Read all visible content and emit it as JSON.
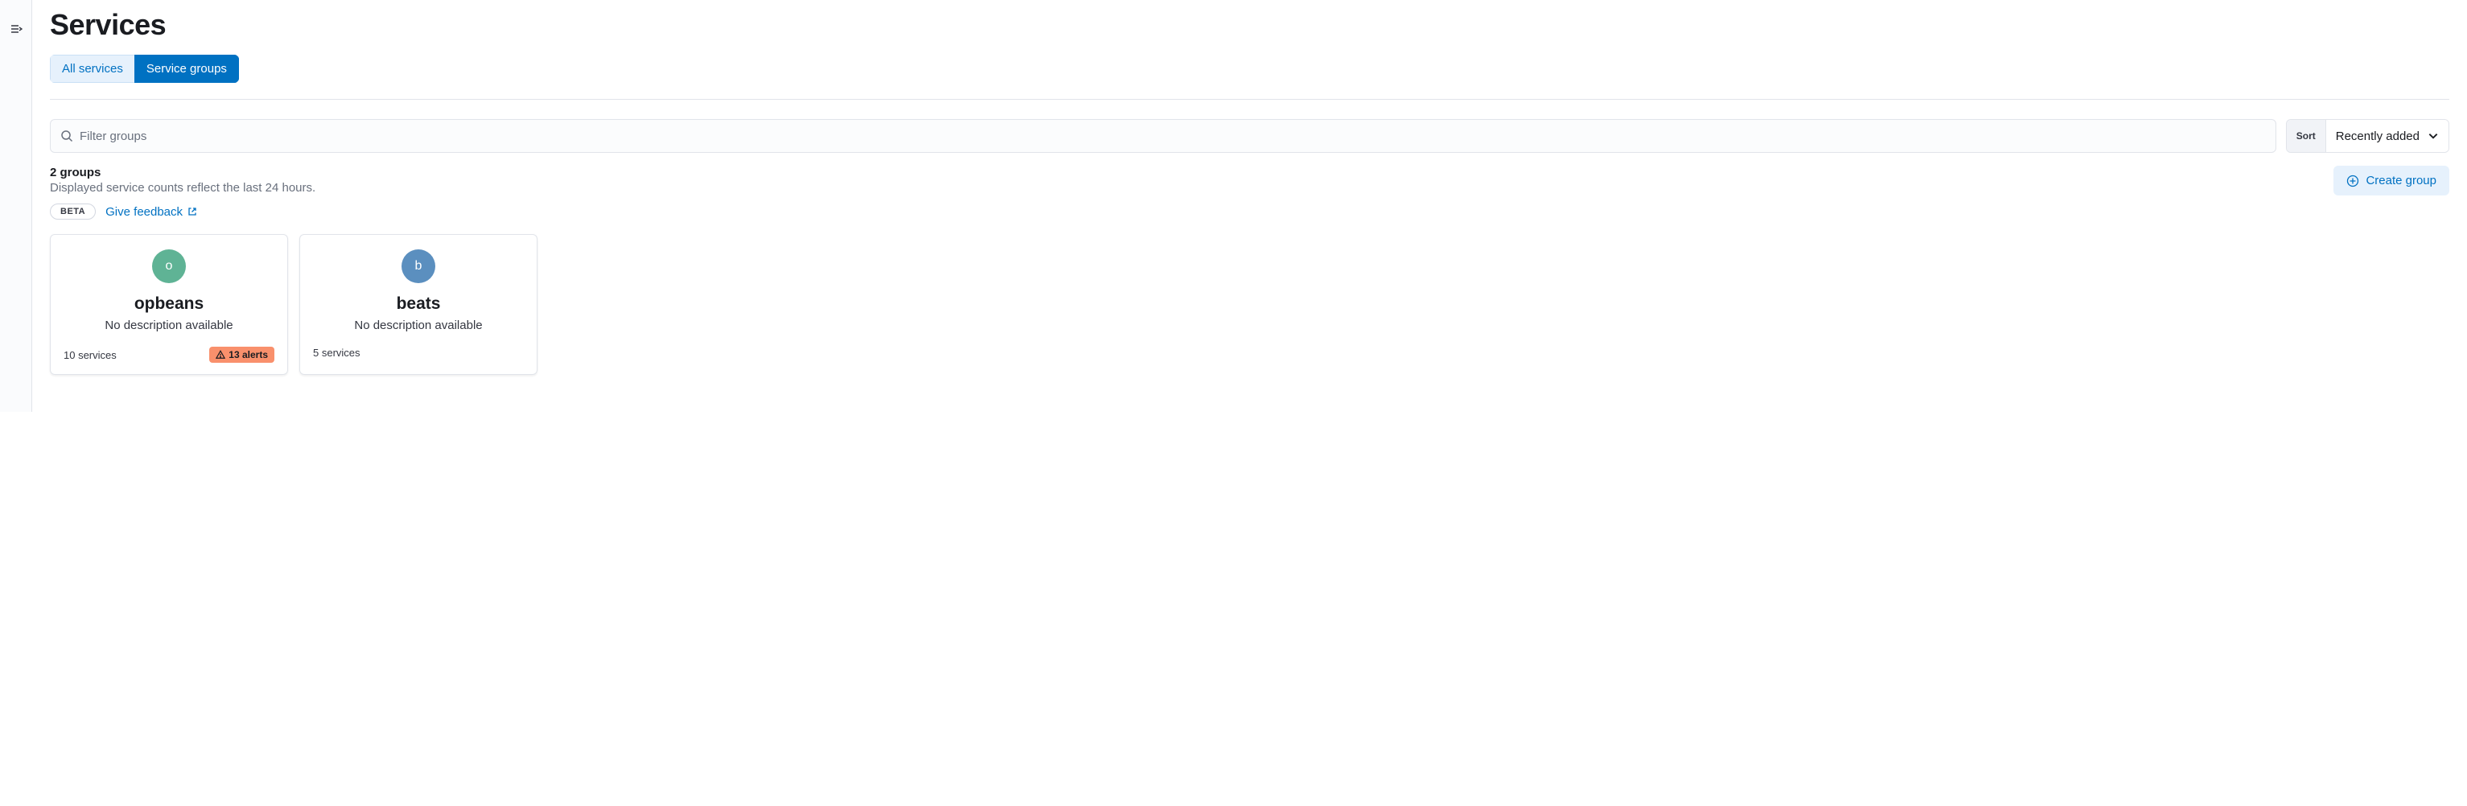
{
  "header": {
    "title": "Services"
  },
  "tabs": {
    "all_services": "All services",
    "service_groups": "Service groups"
  },
  "filter": {
    "placeholder": "Filter groups"
  },
  "sort": {
    "label": "Sort",
    "value": "Recently added"
  },
  "summary": {
    "count": "2 groups",
    "hint": "Displayed service counts reflect the last 24 hours."
  },
  "actions": {
    "create_group": "Create group"
  },
  "feedback": {
    "badge": "BETA",
    "link": "Give feedback"
  },
  "groups": [
    {
      "avatar_letter": "o",
      "avatar_color": "#5fb395",
      "name": "opbeans",
      "description": "No description available",
      "services": "10 services",
      "alerts": "13 alerts"
    },
    {
      "avatar_letter": "b",
      "avatar_color": "#5b8fbf",
      "name": "beats",
      "description": "No description available",
      "services": "5 services",
      "alerts": null
    }
  ]
}
